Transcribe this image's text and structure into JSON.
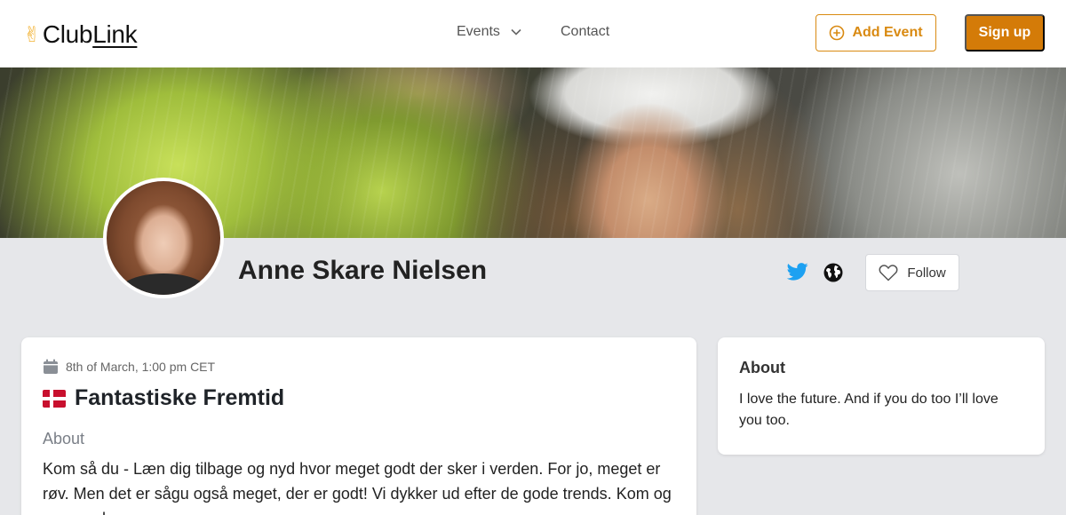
{
  "nav": {
    "logo_text_plain": "Club",
    "logo_text_link": "Link",
    "logo_icon": "victory-hand-icon",
    "events_label": "Events",
    "contact_label": "Contact",
    "add_event_label": "Add Event",
    "signup_label": "Sign up"
  },
  "profile": {
    "name": "Anne Skare Nielsen",
    "follow_label": "Follow",
    "social_icons": [
      "twitter-icon",
      "globe-icon"
    ]
  },
  "event": {
    "date": "8th of March, 1:00 pm CET",
    "flag_icon": "denmark-flag-icon",
    "title": "Fantastiske Fremtid",
    "about_label": "About",
    "description": "Kom så du - Læn dig tilbage og nyd hvor meget godt der sker i verden. For jo, meget er røv. Men det er sågu også meget, der er godt! Vi dykker ud efter de gode trends. Kom og vær med."
  },
  "about": {
    "heading": "About",
    "text": "I love the future. And if you do too I’ll love you too."
  },
  "colors": {
    "accent": "#d47b08",
    "twitter": "#1da1f2",
    "page_bg": "#e6e7ea"
  }
}
